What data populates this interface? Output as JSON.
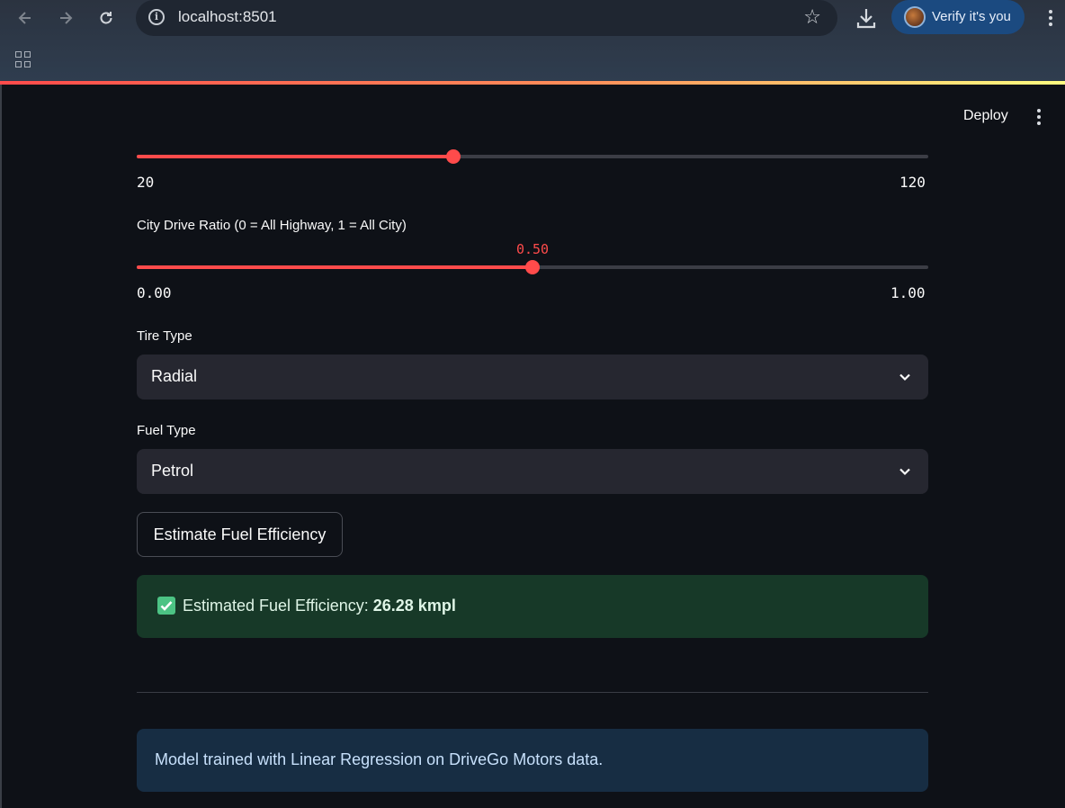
{
  "browser": {
    "url": "localhost:8501",
    "profile_label": "Verify it's you",
    "icons": [
      "back-icon",
      "forward-icon",
      "reload-icon",
      "info-icon",
      "star-icon",
      "download-icon",
      "kebab-icon",
      "apps-icon"
    ]
  },
  "app": {
    "deploy_label": "Deploy",
    "accent_color": "#ff4b4b"
  },
  "slider1": {
    "min_label": "20",
    "max_label": "120",
    "value_fraction": 0.4
  },
  "slider2": {
    "label": "City Drive Ratio (0 = All Highway, 1 = All City)",
    "value_label": "0.50",
    "min_label": "0.00",
    "max_label": "1.00",
    "value_fraction": 0.5
  },
  "tire": {
    "label": "Tire Type",
    "value": "Radial"
  },
  "fuel": {
    "label": "Fuel Type",
    "value": "Petrol"
  },
  "button": {
    "label": "Estimate Fuel Efficiency"
  },
  "result": {
    "prefix": "Estimated Fuel Efficiency: ",
    "value": "26.28 kmpl"
  },
  "info": {
    "text": "Model trained with Linear Regression on DriveGo Motors data."
  }
}
